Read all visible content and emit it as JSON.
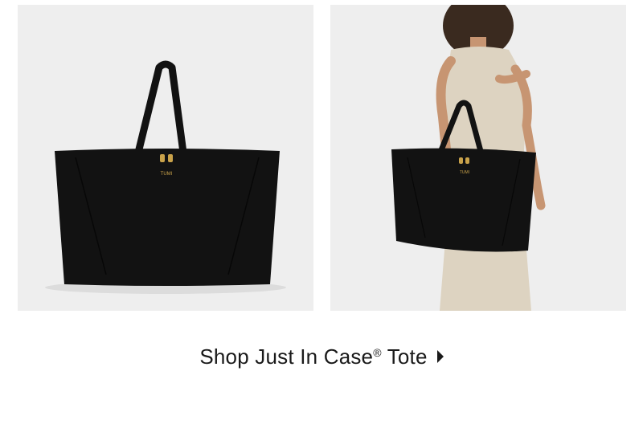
{
  "promo": {
    "left_image_alt": "Just In Case Tote product shot",
    "right_image_alt": "Model carrying Just In Case Tote",
    "bag_brand_mark": "TUMI",
    "cta_before_mark": "Shop Just In Case",
    "cta_mark": "®",
    "cta_after_mark": " Tote",
    "cta_icon": "caret-right-icon"
  },
  "colors": {
    "panel_bg": "#eeeeee",
    "bag": "#121212",
    "hardware": "#c9a24a",
    "dress": "#ddd3c1",
    "skin": "#c79572",
    "hair": "#3a2a1f"
  }
}
